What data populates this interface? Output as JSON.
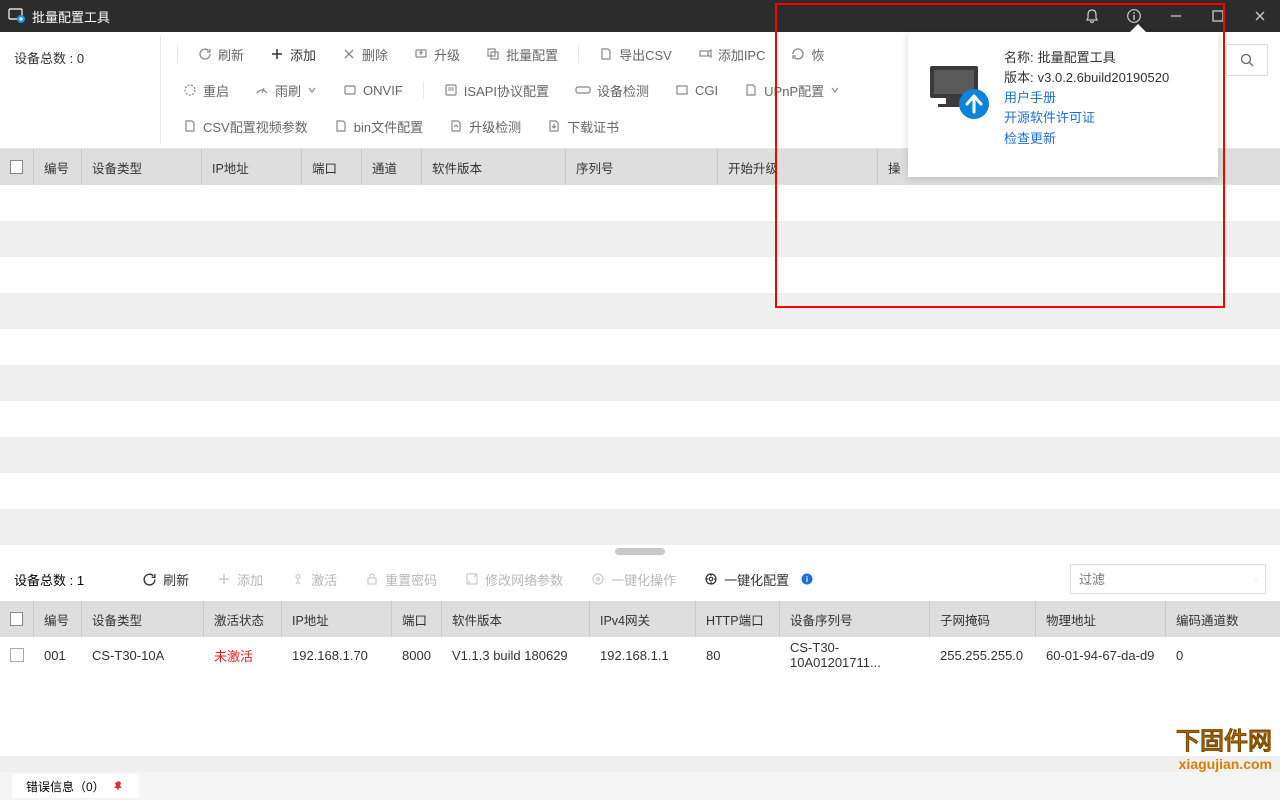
{
  "titlebar": {
    "title": "批量配置工具"
  },
  "upper": {
    "device_count_label": "设备总数 : 0",
    "buttons": {
      "refresh": "刷新",
      "add": "添加",
      "delete": "删除",
      "upgrade": "升级",
      "batch_config": "批量配置",
      "export_csv": "导出CSV",
      "add_ipc": "添加IPC",
      "restore": "恢",
      "reboot": "重启",
      "wiper": "雨刷",
      "onvif": "ONVIF",
      "isapi": "ISAPI协议配置",
      "device_detect": "设备检测",
      "cgi": "CGI",
      "upnp": "UPnP配置",
      "csv_video": "CSV配置视频参数",
      "bin_file": "bin文件配置",
      "upgrade_check": "升级检测",
      "download_cert": "下载证书"
    },
    "columns": {
      "num": "编号",
      "type": "设备类型",
      "ip": "IP地址",
      "port": "端口",
      "channel": "通道",
      "software": "软件版本",
      "serial": "序列号",
      "start_upgrade": "开始升级",
      "operate": "操"
    }
  },
  "lower": {
    "device_count_label": "设备总数 : 1",
    "buttons": {
      "refresh": "刷新",
      "add": "添加",
      "activate": "激活",
      "reset_pwd": "重置密码",
      "modify_net": "修改网络参数",
      "one_click_op": "一键化操作",
      "one_click_cfg": "一键化配置"
    },
    "filter_placeholder": "过滤",
    "columns": {
      "num": "编号",
      "type": "设备类型",
      "activate": "激活状态",
      "ip": "IP地址",
      "port": "端口",
      "software": "软件版本",
      "gateway": "IPv4网关",
      "http_port": "HTTP端口",
      "serial": "设备序列号",
      "mask": "子网掩码",
      "mac": "物理地址",
      "enc_ch": "编码通道数"
    },
    "row": {
      "num": "001",
      "type": "CS-T30-10A",
      "activate": "未激活",
      "ip": "192.168.1.70",
      "port": "8000",
      "software": "V1.1.3 build 180629",
      "gateway": "192.168.1.1",
      "http_port": "80",
      "serial": "CS-T30-10A01201711...",
      "mask": "255.255.255.0",
      "mac": "60-01-94-67-da-d9",
      "enc_ch": "0"
    }
  },
  "popup": {
    "name_label": "名称:",
    "name_value": "批量配置工具",
    "version_label": "版本:",
    "version_value": "v3.0.2.6build20190520",
    "manual": "用户手册",
    "license": "开源软件许可证",
    "check_update": "检查更新"
  },
  "footer": {
    "error_info": "错误信息（0）"
  },
  "watermark": {
    "line1": "下固件网",
    "line2": "xiagujian.com"
  }
}
